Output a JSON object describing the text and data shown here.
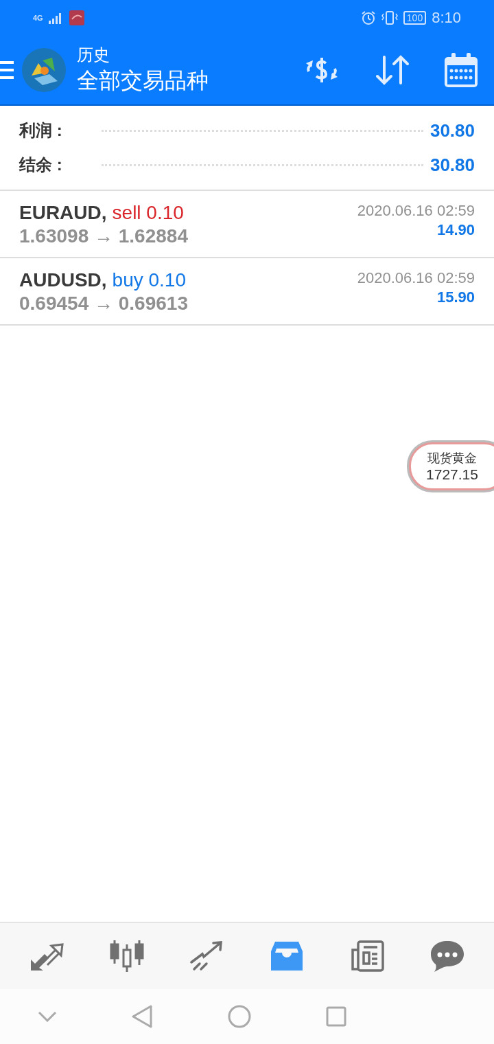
{
  "status_bar": {
    "network": "4G",
    "battery": "100",
    "time": "8:10"
  },
  "header": {
    "title": "历史",
    "subtitle": "全部交易品种"
  },
  "summary": [
    {
      "label": "利润 :",
      "value": "30.80"
    },
    {
      "label": "结余 :",
      "value": "30.80"
    }
  ],
  "trades": [
    {
      "symbol": "EURAUD,",
      "order": "sell 0.10",
      "kind": "sell",
      "prices": "1.63098 → 1.62884",
      "time": "2020.06.16 02:59",
      "profit": "14.90"
    },
    {
      "symbol": "AUDUSD,",
      "order": "buy 0.10",
      "kind": "buy",
      "prices": "0.69454 → 0.69613",
      "time": "2020.06.16 02:59",
      "profit": "15.90"
    }
  ],
  "quote": {
    "name": "现货黄金",
    "price": "1727.15"
  },
  "nav": [
    {
      "kind": "trade",
      "selected": false
    },
    {
      "kind": "chart",
      "selected": false
    },
    {
      "kind": "trend",
      "selected": false
    },
    {
      "kind": "history",
      "selected": true
    },
    {
      "kind": "news",
      "selected": false
    },
    {
      "kind": "chat",
      "selected": false
    }
  ]
}
